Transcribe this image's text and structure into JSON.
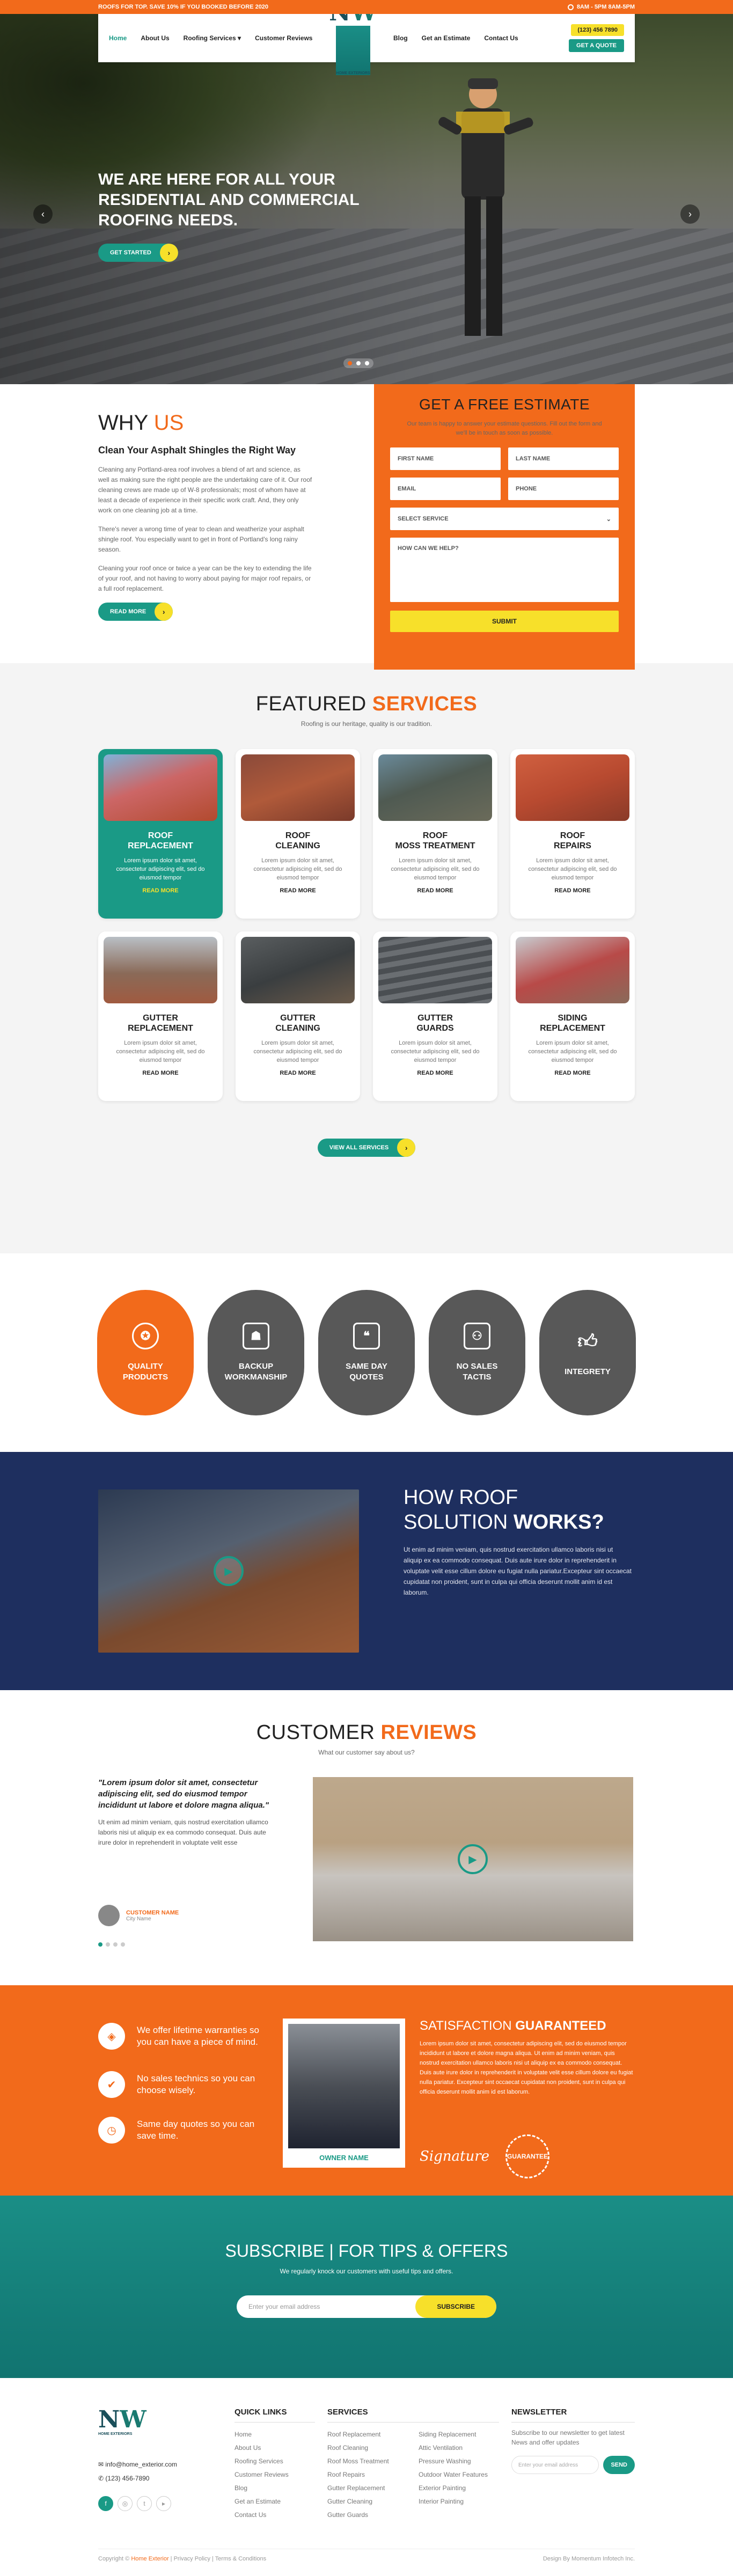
{
  "topbar": {
    "promo": "ROOFS FOR TOP. SAVE 10% IF YOU BOOKED BEFORE 2020",
    "hours": "8AM - 5PM 8AM-5PM"
  },
  "nav": {
    "left": [
      "Home",
      "About Us",
      "Roofing Services",
      "Customer Reviews"
    ],
    "right": [
      "Blog",
      "Get an Estimate",
      "Contact Us"
    ],
    "phone": "(123) 456 7890",
    "quote": "GET A QUOTE"
  },
  "logo": {
    "mark_n": "N",
    "mark_w": "W",
    "sub": "HOME EXTERIORS"
  },
  "hero": {
    "title": "WE ARE HERE FOR ALL YOUR RESIDENTIAL AND COMMERCIAL ROOFING NEEDS.",
    "cta": "GET STARTED"
  },
  "why": {
    "title_a": "WHY",
    "title_b": "US",
    "subtitle": "Clean Your Asphalt Shingles the Right Way",
    "p1": "Cleaning any Portland-area roof involves a blend of art and science, as well as making sure the right people are the undertaking care of it. Our roof cleaning crews are made up of W-8 professionals; most of whom have at least a decade of experience in their specific work craft. And, they only work on one cleaning job at a time.",
    "p2": "There's never a wrong time of year to clean and weatherize your asphalt shingle roof. You especially want to get in front of Portland's long rainy season.",
    "p3": "Cleaning your roof once or twice a year can be the key to extending the life of your roof, and not having to worry about paying for major roof repairs, or a full roof replacement.",
    "cta": "READ MORE"
  },
  "estimate": {
    "title": "GET A FREE ESTIMATE",
    "intro": "Our team is happy to answer  your estimate questions. Fill out the form and we'll be in touch as soon as possible.",
    "first": "FIRST NAME",
    "last": "LAST NAME",
    "email": "EMAIL",
    "phone": "PHONE",
    "service": "SELECT SERVICE",
    "help": "HOW CAN WE HELP?",
    "submit": "SUBMIT"
  },
  "services": {
    "title_a": "FEATURED",
    "title_b": "SERVICES",
    "sub": "Roofing is our heritage, quality is our tradition.",
    "cards": [
      {
        "t1": "ROOF",
        "t2": "REPLACEMENT",
        "desc": "Lorem ipsum dolor sit amet, consectetur adipiscing elit, sed do eiusmod tempor",
        "more": "READ MORE"
      },
      {
        "t1": "ROOF",
        "t2": "CLEANING",
        "desc": "Lorem ipsum dolor sit amet, consectetur adipiscing elit, sed do eiusmod tempor",
        "more": "READ MORE"
      },
      {
        "t1": "ROOF",
        "t2": "MOSS TREATMENT",
        "desc": "Lorem ipsum dolor sit amet, consectetur adipiscing elit, sed do eiusmod tempor",
        "more": "READ MORE"
      },
      {
        "t1": "ROOF",
        "t2": "REPAIRS",
        "desc": "Lorem ipsum dolor sit amet, consectetur adipiscing elit, sed do eiusmod tempor",
        "more": "READ MORE"
      },
      {
        "t1": "GUTTER",
        "t2": "REPLACEMENT",
        "desc": "Lorem ipsum dolor sit amet, consectetur adipiscing elit, sed do eiusmod tempor",
        "more": "READ MORE"
      },
      {
        "t1": "GUTTER",
        "t2": "CLEANING",
        "desc": "Lorem ipsum dolor sit amet, consectetur adipiscing elit, sed do eiusmod tempor",
        "more": "READ MORE"
      },
      {
        "t1": "GUTTER",
        "t2": "GUARDS",
        "desc": "Lorem ipsum dolor sit amet, consectetur adipiscing elit, sed do eiusmod tempor",
        "more": "READ MORE"
      },
      {
        "t1": "SIDING",
        "t2": "REPLACEMENT",
        "desc": "Lorem ipsum dolor sit amet, consectetur adipiscing elit, sed do eiusmod tempor",
        "more": "READ MORE"
      }
    ],
    "all": "VIEW ALL SERVICES"
  },
  "values": [
    {
      "l1": "QUALITY",
      "l2": "PRODUCTS"
    },
    {
      "l1": "BACKUP",
      "l2": "WORKMANSHIP"
    },
    {
      "l1": "SAME DAY",
      "l2": "QUOTES"
    },
    {
      "l1": "NO SALES",
      "l2": "TACTIS"
    },
    {
      "l1": "INTEGRETY",
      "l2": ""
    }
  ],
  "how": {
    "t1": "HOW ROOF",
    "t2": "SOLUTION",
    "t3": "WORKS?",
    "body": "Ut enim ad minim veniam, quis nostrud exercitation ullamco laboris nisi ut aliquip ex ea commodo consequat. Duis aute irure dolor in reprehenderit in voluptate velit esse cillum dolore eu fugiat nulla pariatur.Excepteur sint occaecat cupidatat non proident, sunt in culpa qui officia deserunt mollit anim id est laborum."
  },
  "reviews": {
    "title_a": "CUSTOMER",
    "title_b": "REVIEWS",
    "sub": "What our customer say about us?",
    "quote": "\"Lorem ipsum dolor sit amet, consectetur adipiscing elit, sed do eiusmod tempor incididunt ut labore et dolore magna aliqua.\"",
    "body": "Ut enim ad minim veniam, quis nostrud exercitation ullamco laboris nisi ut aliquip ex ea commodo consequat. Duis aute irure dolor in reprehenderit in voluptate velit esse",
    "name": "CUSTOMER NAME",
    "city": "City Name"
  },
  "guar": {
    "b1": "We offer lifetime warranties so you can have a piece of mind.",
    "b2": "No sales technics so you can choose wisely.",
    "b3": "Same day quotes so you can save time.",
    "owner": "OWNER NAME",
    "title_a": "SATISFACTION",
    "title_b": "GUARANTEED",
    "body": "Lorem ipsum dolor sit amet, consectetur adipiscing elit, sed do eiusmod tempor incididunt ut labore et dolore magna aliqua. Ut enim ad minim veniam, quis nostrud exercitation ullamco laboris nisi ut aliquip ex ea commodo consequat. Duis aute irure dolor in reprehenderit in voluptate velit esse cillum dolore eu fugiat nulla pariatur. Excepteur sint occaecat cupidatat non proident, sunt in culpa qui officia deserunt mollit anim id est laborum.",
    "signature": "Signature",
    "seal": "GUARANTEE"
  },
  "subscribe": {
    "title_a": "SUBSCRIBE",
    "title_b": " | FOR TIPS & OFFERS",
    "sub": "We regularly knock our customers with useful tips and offers.",
    "placeholder": "Enter your email address",
    "btn": "SUBSCRIBE"
  },
  "footer": {
    "email": "info@home_exterior.com",
    "phone": "(123) 456-7890",
    "quick_title": "QUICK LINKS",
    "quick": [
      "Home",
      "About Us",
      "Roofing Services",
      "Customer Reviews",
      "Blog",
      "Get an Estimate",
      "Contact Us"
    ],
    "services_title": "SERVICES",
    "s1": [
      "Roof Replacement",
      "Roof Cleaning",
      "Roof Moss Treatment",
      "Roof Repairs",
      "Gutter Replacement",
      "Gutter Cleaning",
      "Gutter Guards"
    ],
    "s2": [
      "Siding Replacement",
      "Attic Ventilation",
      "Pressure Washing",
      "Outdoor Water Features",
      "Exterior Painting",
      "Interior Painting"
    ],
    "nl_title": "NEWSLETTER",
    "nl_text": "Subscribe to our newsletter to get latest News and offer updates",
    "nl_placeholder": "Enter your email address",
    "nl_btn": "SEND",
    "copy_pre": "Copyright ©",
    "copy_brand": "Home Exterior",
    "copy_post": " | Privacy Policy | Terms & Conditions",
    "credit": "Design By Momentum Infotech Inc."
  },
  "colors": {
    "orange": "#f26a1b",
    "teal": "#1a9a86",
    "yellow": "#f7e02a",
    "navy": "#1e2f5f"
  }
}
